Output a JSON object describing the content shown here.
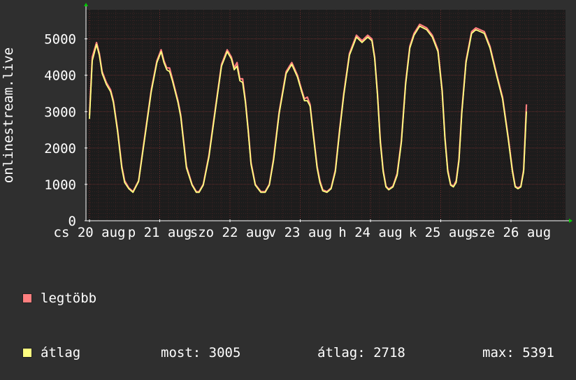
{
  "chart_data": {
    "type": "line",
    "ylabel": "onlinestream.live",
    "ylim": [
      0,
      5800
    ],
    "y_ticks": [
      0,
      1000,
      2000,
      3000,
      4000,
      5000
    ],
    "grid": true,
    "x_tick_labels": [
      {
        "label": "cs 20 aug",
        "day": 0
      },
      {
        "label": "p 21 aug",
        "day": 1
      },
      {
        "label": "szo 22 aug",
        "day": 2
      },
      {
        "label": "v 23 aug",
        "day": 3
      },
      {
        "label": "h 24 aug",
        "day": 4
      },
      {
        "label": "k 25 aug",
        "day": 5
      },
      {
        "label": "sze 26 aug",
        "day": 6
      }
    ],
    "series": [
      {
        "name": "legtöbb",
        "color": "#ff7f7f",
        "x_days": [
          0.0,
          0.04,
          0.1,
          0.14,
          0.18,
          0.24,
          0.3,
          0.34,
          0.4,
          0.46,
          0.5,
          0.56,
          0.62,
          0.7,
          0.8,
          0.88,
          0.96,
          1.02,
          1.06,
          1.1,
          1.14,
          1.18,
          1.22,
          1.26,
          1.3,
          1.38,
          1.46,
          1.52,
          1.56,
          1.62,
          1.7,
          1.8,
          1.88,
          1.96,
          2.02,
          2.06,
          2.1,
          2.14,
          2.18,
          2.22,
          2.26,
          2.3,
          2.36,
          2.44,
          2.5,
          2.56,
          2.62,
          2.7,
          2.8,
          2.88,
          2.96,
          3.02,
          3.06,
          3.1,
          3.14,
          3.18,
          3.24,
          3.28,
          3.32,
          3.38,
          3.44,
          3.5,
          3.56,
          3.62,
          3.7,
          3.8,
          3.88,
          3.96,
          4.02,
          4.06,
          4.1,
          4.14,
          4.18,
          4.22,
          4.26,
          4.32,
          4.38,
          4.44,
          4.5,
          4.56,
          4.62,
          4.7,
          4.8,
          4.88,
          4.96,
          5.02,
          5.06,
          5.1,
          5.14,
          5.18,
          5.22,
          5.26,
          5.3,
          5.36,
          5.44,
          5.5,
          5.56,
          5.62,
          5.7,
          5.8,
          5.88,
          5.96,
          6.02,
          6.06,
          6.1,
          6.14,
          6.18,
          6.22,
          6.26,
          6.3,
          6.36,
          6.42,
          6.48,
          6.54,
          6.6,
          6.66,
          6.72
        ],
        "values": [
          2900,
          4500,
          4900,
          4600,
          4100,
          3800,
          3600,
          3300,
          2500,
          1500,
          1100,
          900,
          800,
          1100,
          2500,
          3600,
          4400,
          4700,
          4400,
          4200,
          4200,
          3900,
          3600,
          3300,
          2900,
          1500,
          1000,
          800,
          800,
          1000,
          1800,
          3200,
          4300,
          4700,
          4500,
          4200,
          4350,
          3900,
          3900,
          3300,
          2500,
          1600,
          1000,
          800,
          800,
          1000,
          1700,
          3000,
          4100,
          4350,
          4000,
          3600,
          3350,
          3400,
          3200,
          2500,
          1500,
          1100,
          850,
          800,
          900,
          1400,
          2500,
          3500,
          4600,
          5100,
          4950,
          5100,
          5000,
          4500,
          3500,
          2200,
          1400,
          950,
          870,
          950,
          1300,
          2200,
          3800,
          4800,
          5150,
          5400,
          5300,
          5100,
          4700,
          3600,
          2300,
          1400,
          1000,
          950,
          1100,
          1700,
          3000,
          4400,
          5200,
          5300,
          5250,
          5200,
          4800,
          4000,
          3400,
          2300,
          1400,
          950,
          900,
          950,
          1400,
          3200
        ],
        "last": 3200
      },
      {
        "name": "átlag",
        "color": "#ffff80",
        "x_days": [
          0.0,
          0.04,
          0.1,
          0.14,
          0.18,
          0.24,
          0.3,
          0.34,
          0.4,
          0.46,
          0.5,
          0.56,
          0.62,
          0.7,
          0.8,
          0.88,
          0.96,
          1.02,
          1.06,
          1.1,
          1.14,
          1.18,
          1.22,
          1.26,
          1.3,
          1.38,
          1.46,
          1.52,
          1.56,
          1.62,
          1.7,
          1.8,
          1.88,
          1.96,
          2.02,
          2.06,
          2.1,
          2.14,
          2.18,
          2.22,
          2.26,
          2.3,
          2.36,
          2.44,
          2.5,
          2.56,
          2.62,
          2.7,
          2.8,
          2.88,
          2.96,
          3.02,
          3.06,
          3.1,
          3.14,
          3.18,
          3.24,
          3.28,
          3.32,
          3.38,
          3.44,
          3.5,
          3.56,
          3.62,
          3.7,
          3.8,
          3.88,
          3.96,
          4.02,
          4.06,
          4.1,
          4.14,
          4.18,
          4.22,
          4.26,
          4.32,
          4.38,
          4.44,
          4.5,
          4.56,
          4.62,
          4.7,
          4.8,
          4.88,
          4.96,
          5.02,
          5.06,
          5.1,
          5.14,
          5.18,
          5.22,
          5.26,
          5.3,
          5.36,
          5.44,
          5.5,
          5.56,
          5.62,
          5.7,
          5.8,
          5.88,
          5.96,
          6.02,
          6.06,
          6.1,
          6.14,
          6.18,
          6.22,
          6.26,
          6.3,
          6.36,
          6.42,
          6.48,
          6.54,
          6.6,
          6.66,
          6.72
        ],
        "values": [
          2800,
          4400,
          4850,
          4550,
          4050,
          3750,
          3550,
          3250,
          2450,
          1450,
          1050,
          880,
          780,
          1080,
          2450,
          3550,
          4350,
          4650,
          4350,
          4150,
          4100,
          3850,
          3550,
          3250,
          2850,
          1450,
          980,
          780,
          780,
          980,
          1750,
          3150,
          4250,
          4650,
          4450,
          4150,
          4250,
          3850,
          3800,
          3250,
          2450,
          1550,
          980,
          780,
          780,
          980,
          1650,
          2950,
          4050,
          4300,
          3950,
          3550,
          3300,
          3300,
          3150,
          2450,
          1450,
          1050,
          820,
          780,
          880,
          1350,
          2450,
          3450,
          4550,
          5050,
          4900,
          5050,
          4950,
          4450,
          3450,
          2150,
          1350,
          930,
          850,
          930,
          1250,
          2150,
          3750,
          4750,
          5100,
          5350,
          5250,
          5050,
          4650,
          3550,
          2250,
          1350,
          980,
          930,
          1050,
          1650,
          2950,
          4350,
          5150,
          5250,
          5200,
          5150,
          4750,
          3950,
          3350,
          2250,
          1350,
          930,
          880,
          930,
          1350,
          3005
        ],
        "last": 3005
      }
    ]
  },
  "legend": {
    "max_label": "legtöbb",
    "avg_label": "átlag",
    "now_label": "most: 3005",
    "avg_stat": "átlag: 2718",
    "max_stat": "max: 5391"
  },
  "colors": {
    "background": "#2f2f2f",
    "plot_background": "#1c1c1c",
    "grid_minor": "#5a2a2a",
    "grid_major": "#7a3030",
    "axis": "#ffffff",
    "arrow": "#00cc00"
  }
}
